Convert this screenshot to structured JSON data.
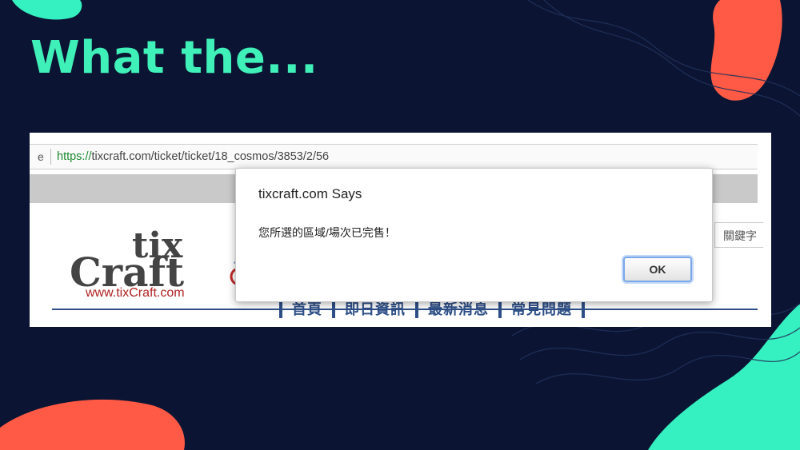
{
  "slide": {
    "title": "What the..."
  },
  "browser": {
    "url_prefix": "e",
    "url_scheme": "https://",
    "url_rest": "tixcraft.com/ticket/ticket/18_cosmos/3853/2/56"
  },
  "site": {
    "logo_text": "tixCraft",
    "logo_url": "www.tixCraft.com",
    "keyword_label": "關鍵字",
    "nav": [
      "首頁",
      "即日資訊",
      "最新消息",
      "常見問題"
    ]
  },
  "dialog": {
    "title": "tixcraft.com Says",
    "message": "您所選的區域/場次已完售！",
    "ok_label": "OK"
  },
  "colors": {
    "background": "#0b1533",
    "title": "#3ff0b8",
    "coral": "#ff5a45",
    "teal": "#35f0c0"
  }
}
